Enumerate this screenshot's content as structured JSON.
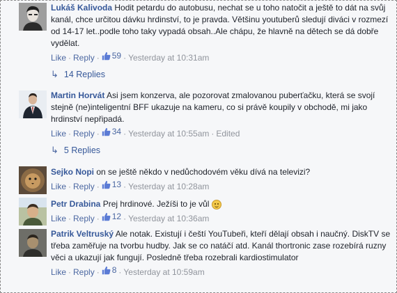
{
  "comments": [
    {
      "author": "Lukáš Kalivoda",
      "text": "Hodit petardu do autobusu, nechat se u toho natočit a ještě to dát na svůj kanál, chce určitou dávku hrdinství, to je pravda. Většinu youtuberů sledují diváci v rozmezí od 14-17 let..podle toho taky vypadá obsah..Ale chápu, že hlavně na dětech se dá dobře vydělat.",
      "like_label": "Like",
      "reply_label": "Reply",
      "likes": "59",
      "time": "Yesterday at 10:31am",
      "avatar_icon": "avatar-man-dark-hair",
      "replies_label": "14 Replies"
    },
    {
      "author": "Martin Horvát",
      "text": "Asi jsem konzerva, ale pozorovat zmalovanou puberťačku, která se svojí stejně (ne)inteligentní BFF ukazuje na kameru, co si právě koupily v obchodě, mi jako hrdinství nepřipadá.",
      "like_label": "Like",
      "reply_label": "Reply",
      "likes": "34",
      "time": "Yesterday at 10:55am",
      "edited": "Edited",
      "avatar_icon": "avatar-man-suit",
      "replies_label": "5 Replies"
    },
    {
      "author": "Sejko Nopi",
      "text": "on se ještě někdo v nedůchodovém věku dívá na televizi?",
      "like_label": "Like",
      "reply_label": "Reply",
      "likes": "13",
      "time": "Yesterday at 10:28am",
      "avatar_icon": "avatar-lion"
    },
    {
      "author": "Petr Drabina",
      "text_before_emoji": "Prej hrdinové. Ježíši to je vůl",
      "emoji": "smile-emoji",
      "like_label": "Like",
      "reply_label": "Reply",
      "likes": "12",
      "time": "Yesterday at 10:36am",
      "avatar_icon": "avatar-man-outdoor"
    },
    {
      "author": "Patrik Veltruský",
      "text": "Ale notak. Existují i čeští YouTubeři, kteří dělají obsah i naučný. DiskTV se třeba zaměřuje na tvorbu hudby. Jak se co natáčí atd. Kanál thortronic zase rozebírá ruzny věci a ukazují jak fungují. Posledně třeba rozebrali kardiostimulator",
      "like_label": "Like",
      "reply_label": "Reply",
      "likes": "8",
      "time": "Yesterday at 10:59am",
      "avatar_icon": "avatar-man-dark"
    }
  ],
  "colors": {
    "link": "#365899",
    "action": "#4b67a1",
    "meta": "#90949c",
    "background": "#f6f7f9"
  }
}
